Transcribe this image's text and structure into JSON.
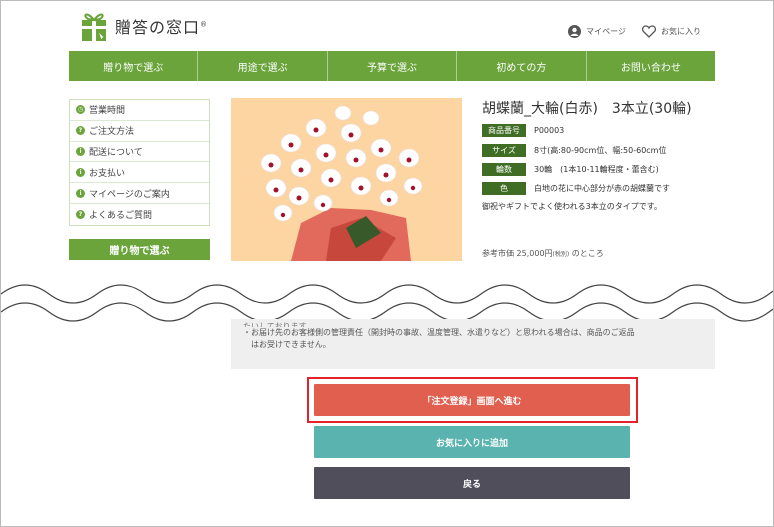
{
  "header": {
    "logo_text": "贈答の窓口",
    "logo_mark": "®",
    "links": [
      {
        "label": "マイページ",
        "icon": "user-icon"
      },
      {
        "label": "お気に入り",
        "icon": "heart-icon"
      }
    ]
  },
  "nav": {
    "items": [
      "贈り物で選ぶ",
      "用途で選ぶ",
      "予算で選ぶ",
      "初めての方",
      "お問い合わせ"
    ]
  },
  "sidebar": {
    "items": [
      {
        "label": "営業時間",
        "icon": "clock-icon",
        "glyph": "◷"
      },
      {
        "label": "ご注文方法",
        "icon": "question-icon",
        "glyph": "?"
      },
      {
        "label": "配送について",
        "icon": "info-icon",
        "glyph": "i"
      },
      {
        "label": "お支払い",
        "icon": "info-icon",
        "glyph": "i"
      },
      {
        "label": "マイページのご案内",
        "icon": "info-icon",
        "glyph": "i"
      },
      {
        "label": "よくあるご質問",
        "icon": "question-icon",
        "glyph": "?"
      }
    ],
    "button_label": "贈り物で選ぶ"
  },
  "product": {
    "title": "胡蝶蘭_大輪(白赤)　3本立(30輪)",
    "specs": [
      {
        "label": "商品番号",
        "value": "P00003"
      },
      {
        "label": "サイズ",
        "value": "8寸(高:80-90cm位、幅:50-60cm位"
      },
      {
        "label": "輪数",
        "value": "30輪　(1本10-11輪程度・蕾含む)"
      },
      {
        "label": "色",
        "value": "白地の花に中心部分が赤の胡蝶蘭です"
      }
    ],
    "description": "御祝やギフトでよく使われる3本立のタイプです。",
    "price_prefix": "参考市価 25,000円",
    "price_tax": "(税別)",
    "price_suffix": "のところ"
  },
  "notice": {
    "cut_line": "たいしております。",
    "line1": "・お届け先のお客様側の管理責任（開封時の事故、温度管理、水遣りなど）と思われる場合は、商品のご返品",
    "line2": "はお受けできません。"
  },
  "buttons": {
    "order": "「注文登録」画面へ進む",
    "favorite": "お気に入りに追加",
    "back": "戻る"
  },
  "colors": {
    "brand_green": "#6aa43b",
    "dark_green": "#3f6d24",
    "order_red": "#e05f4f",
    "fav_teal": "#5ab3af",
    "back_dark": "#4f4e5a",
    "highlight": "#e2232a"
  }
}
